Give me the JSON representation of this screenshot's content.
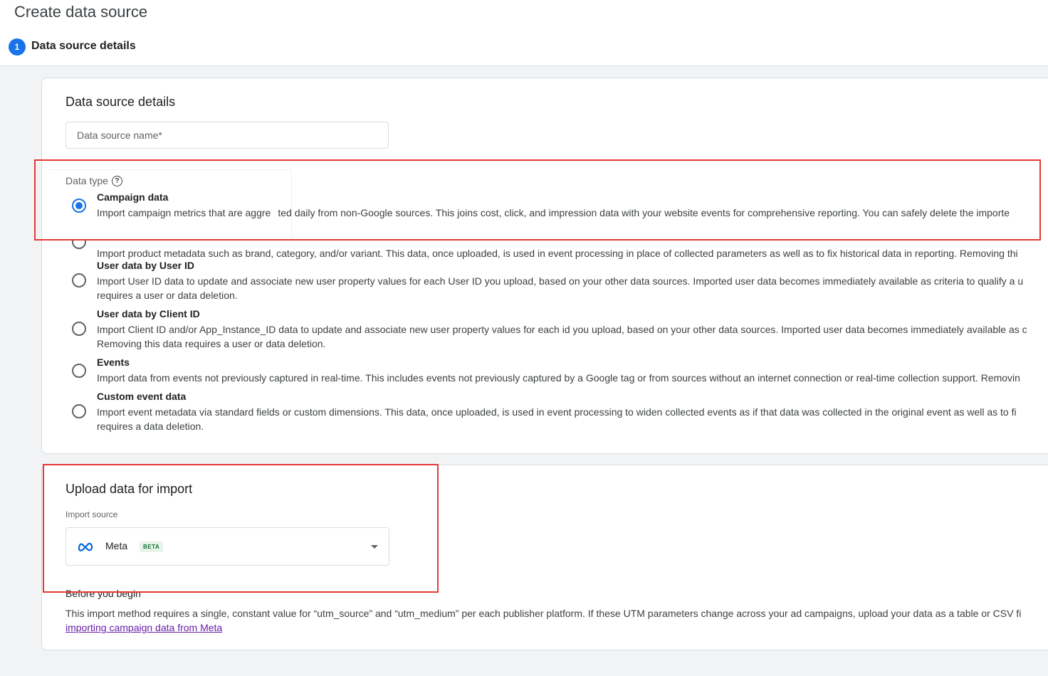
{
  "page": {
    "title": "Create data source",
    "step_number": "1",
    "step_label": "Data source details"
  },
  "details_card": {
    "title": "Data source details",
    "name_placeholder": "Data source name*",
    "data_type_label": "Data type",
    "help_icon_glyph": "?",
    "options": [
      {
        "title": "Campaign data",
        "desc": [
          "Import campaign metrics that are aggre",
          "ted daily from non-Google sources. This joins cost, click, and impression data with your website events for comprehensive reporting. You can safely delete the importe"
        ],
        "checked": true
      },
      {
        "title": "",
        "desc": [
          "Import product metadata such as brand, category, and/or variant. This data, once uploaded, is used in event processing in place of collected parameters as well as to fix historical data in reporting. Removing thi"
        ],
        "checked": false
      },
      {
        "title": "User data by User ID",
        "desc": [
          "Import User ID data to update and associate new user property values for each User ID you upload, based on your other data sources. Imported user data becomes immediately available as criteria to qualify a u",
          "requires a user or data deletion."
        ],
        "checked": false
      },
      {
        "title": "User data by Client ID",
        "desc": [
          "Import Client ID and/or App_Instance_ID data to update and associate new user property values for each id you upload, based on your other data sources. Imported user data becomes immediately available as c",
          "Removing this data requires a user or data deletion."
        ],
        "checked": false
      },
      {
        "title": "Events",
        "desc": [
          "Import data from events not previously captured in real-time. This includes events not previously captured by a Google tag or from sources without an internet connection or real-time collection support. Removin"
        ],
        "checked": false
      },
      {
        "title": "Custom event data",
        "desc": [
          "Import event metadata via standard fields or custom dimensions. This data, once uploaded, is used in event processing to widen collected events as if that data was collected in the original event as well as to fi",
          "requires a data deletion."
        ],
        "checked": false
      }
    ]
  },
  "upload_card": {
    "title": "Upload data for import",
    "import_source_label": "Import source",
    "selected_source": "Meta",
    "beta_badge": "BETA",
    "before_title": "Before you begin",
    "before_desc": "This import method requires a single, constant value for “utm_source” and “utm_medium” per each publisher platform. If these UTM parameters change across your ad campaigns, upload your data as a table or CSV fi",
    "before_link": "importing campaign data from Meta"
  },
  "colors": {
    "accent": "#1a73e8",
    "highlight": "#e53935",
    "link": "#681da8"
  },
  "icons": {
    "meta": "meta-logo-icon",
    "dropdown": "chevron-down-icon",
    "help": "help-circle-icon"
  }
}
